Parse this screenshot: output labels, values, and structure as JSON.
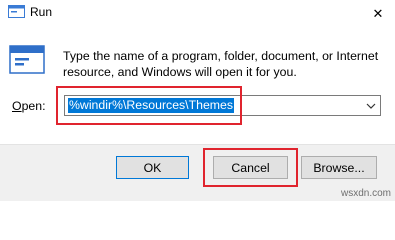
{
  "window": {
    "title": "Run",
    "close_glyph": "✕",
    "app_icon": "run-app-icon",
    "close_icon": "close-icon"
  },
  "main": {
    "icon": "run-dialog-icon",
    "instructions": "Type the name of a program, folder, document, or Internet resource, and Windows will open it for you.",
    "open_label_underlined": "O",
    "open_label_rest": "pen:",
    "input_value": "%windir%\\Resources\\Themes",
    "dropdown_icon": "chevron-down-icon"
  },
  "buttons": {
    "ok": "OK",
    "cancel": "Cancel",
    "browse": "Browse..."
  },
  "watermark": "wsxdn.com",
  "colors": {
    "selection": "#0078d7",
    "highlight_box": "#e0242e",
    "footer_bg": "#f0f0f0",
    "button_bg": "#e1e1e1"
  }
}
